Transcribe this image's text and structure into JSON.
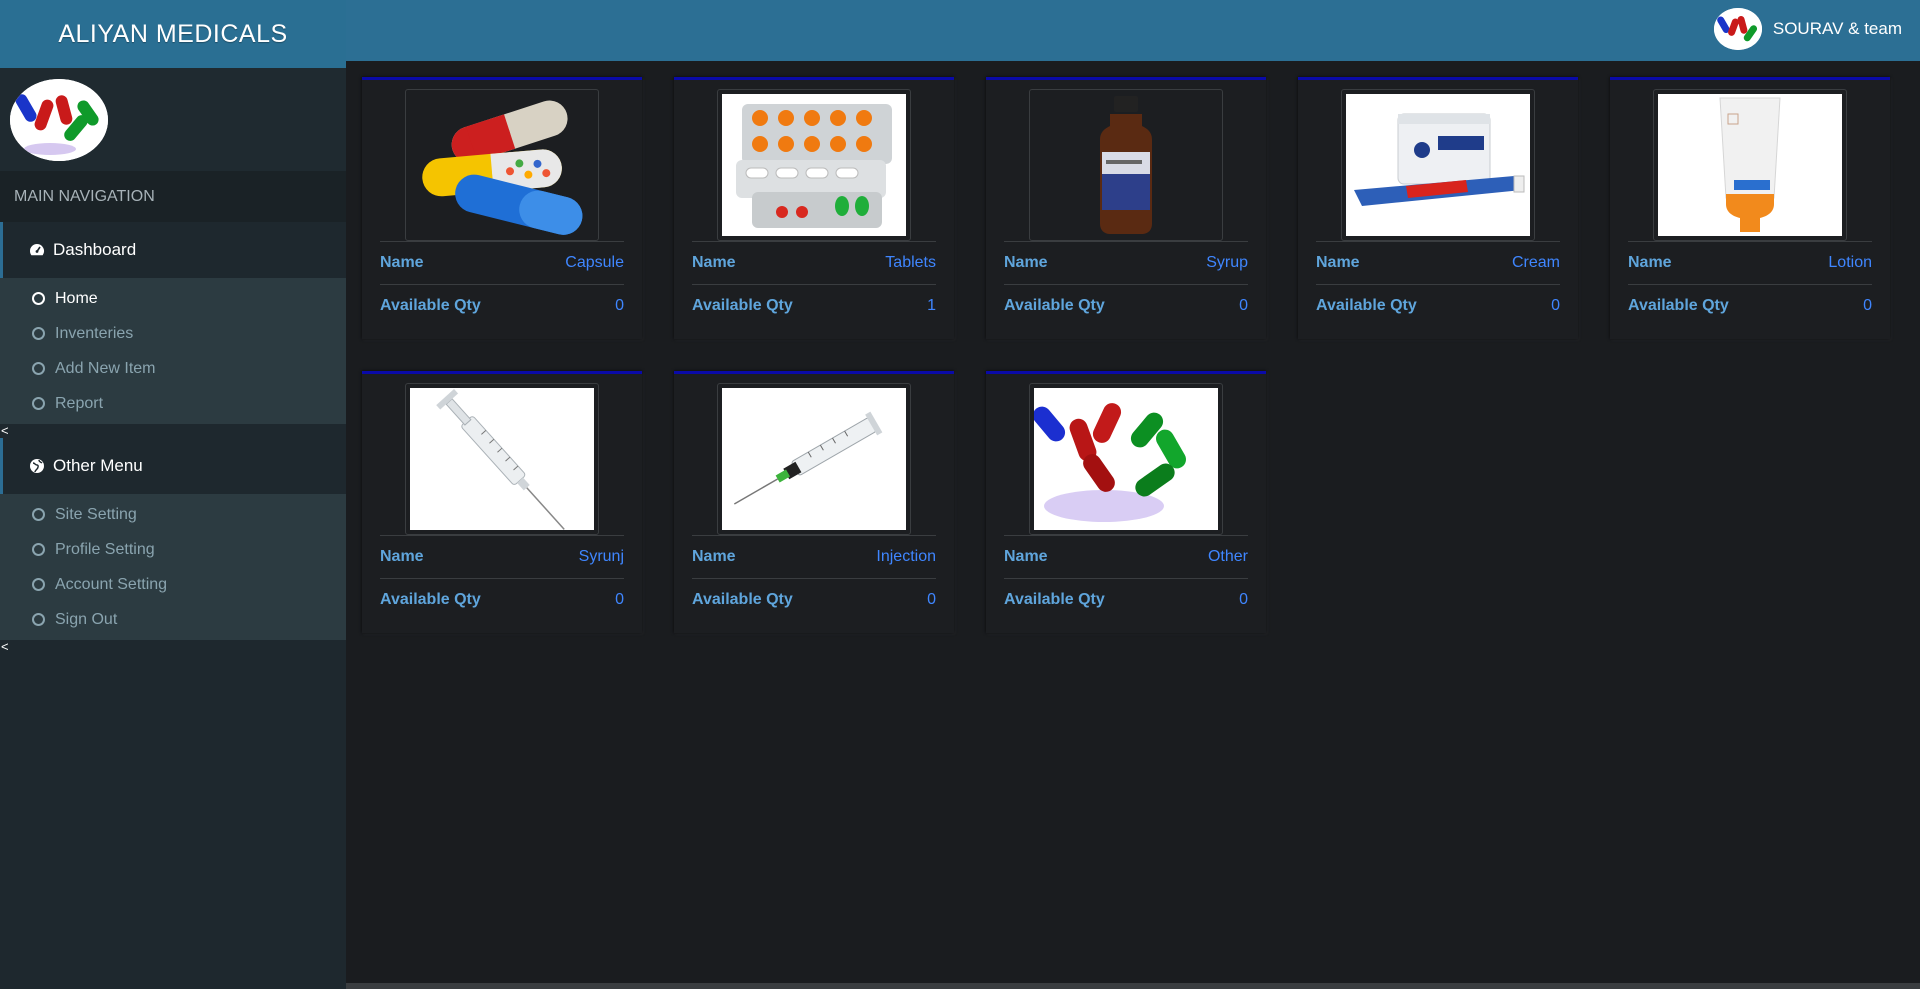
{
  "app": {
    "brand": "ALIYAN MEDICALS",
    "user_name": "SOURAV & team"
  },
  "sidebar": {
    "section_header": "MAIN NAVIGATION",
    "menus": [
      {
        "label": "Dashboard",
        "icon": "dashboard-icon",
        "items": [
          {
            "label": "Home",
            "active": true
          },
          {
            "label": "Inventeries"
          },
          {
            "label": "Add New Item"
          },
          {
            "label": "Report"
          }
        ]
      },
      {
        "label": "Other Menu",
        "icon": "globe-icon",
        "items": [
          {
            "label": "Site Setting"
          },
          {
            "label": "Profile Setting"
          },
          {
            "label": "Account Setting"
          },
          {
            "label": "Sign Out"
          }
        ]
      }
    ],
    "collapse_glyph": "<"
  },
  "cards": [
    {
      "name_label": "Name",
      "name": "Capsule",
      "qty_label": "Available Qty",
      "qty": "0",
      "image": "capsules"
    },
    {
      "name_label": "Name",
      "name": "Tablets",
      "qty_label": "Available Qty",
      "qty": "1",
      "image": "tablets"
    },
    {
      "name_label": "Name",
      "name": "Syrup",
      "qty_label": "Available Qty",
      "qty": "0",
      "image": "syrup"
    },
    {
      "name_label": "Name",
      "name": "Cream",
      "qty_label": "Available Qty",
      "qty": "0",
      "image": "cream"
    },
    {
      "name_label": "Name",
      "name": "Lotion",
      "qty_label": "Available Qty",
      "qty": "0",
      "image": "lotion"
    },
    {
      "name_label": "Name",
      "name": "Syrunj",
      "qty_label": "Available Qty",
      "qty": "0",
      "image": "syringe"
    },
    {
      "name_label": "Name",
      "name": "Injection",
      "qty_label": "Available Qty",
      "qty": "0",
      "image": "injection"
    },
    {
      "name_label": "Name",
      "name": "Other",
      "qty_label": "Available Qty",
      "qty": "0",
      "image": "pills"
    }
  ],
  "colors": {
    "header": "#2c6f94",
    "sidebar": "#1e282e",
    "card_top": "#0a0aa8",
    "label": "#5fa5dc",
    "value": "#3f86ff"
  }
}
